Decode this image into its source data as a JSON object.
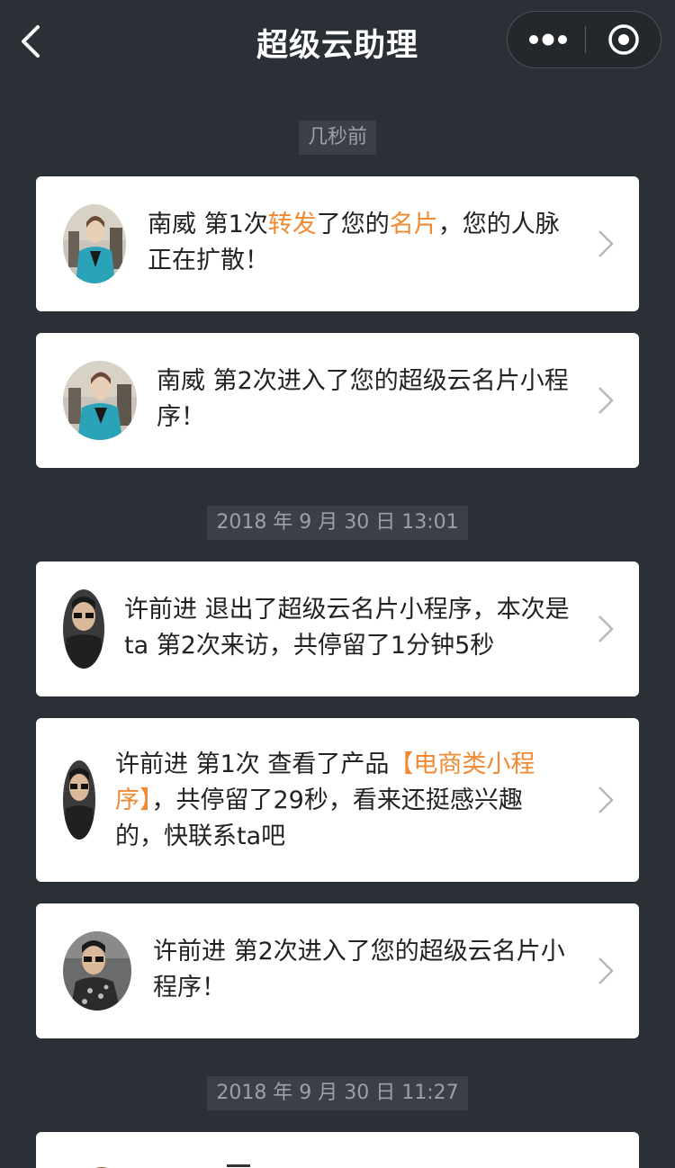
{
  "nav": {
    "title": "超级云助理",
    "back_icon": "back-chevron-icon",
    "more_icon": "more-dots-icon",
    "close_icon": "target-close-icon"
  },
  "colors": {
    "background": "#2b2f36",
    "highlight": "#f08a33"
  },
  "groups": [
    {
      "time": "几秒前",
      "items": [
        {
          "parts": [
            {
              "text": "南威 第1次"
            },
            {
              "text": "转发",
              "highlight": true
            },
            {
              "text": "了您的"
            },
            {
              "text": "名片",
              "highlight": true
            },
            {
              "text": "，您的人脉"
            }
          ],
          "line2": "正在扩散！"
        },
        {
          "line1": "南威 第2次进入了您的超级云名片小程",
          "line2": "序！"
        }
      ]
    },
    {
      "time": "2018 年 9 月 30 日 13:01",
      "items": [
        {
          "line1": "许前进 退出了超级云名片小程序，本次是",
          "line2": "ta 第2次来访，共停留了1分钟5秒"
        },
        {
          "line1_prefix": "许前进 第1次 查看了产品",
          "line1_highlight": "【电商类小程",
          "line2_highlight": "序】",
          "line2_suffix": "，共停留了29秒，看来还挺感兴趣",
          "line3": "的，快联系ta吧"
        },
        {
          "line1": "许前进 第2次进入了您的超级云名片小",
          "line2": "程序！"
        }
      ]
    },
    {
      "time": "2018 年 9 月 30 日 11:27",
      "items": []
    }
  ]
}
